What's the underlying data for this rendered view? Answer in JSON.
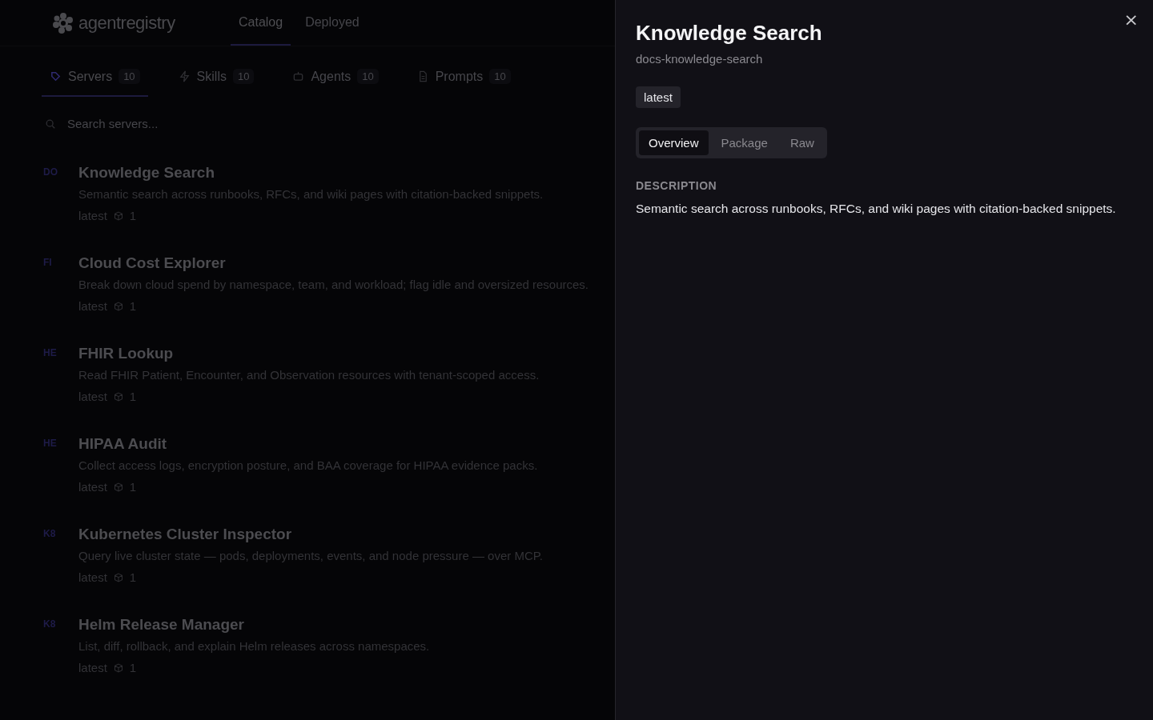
{
  "header": {
    "logo": "agentregistry",
    "nav": [
      {
        "label": "Catalog",
        "selected": true
      },
      {
        "label": "Deployed",
        "selected": false
      }
    ]
  },
  "category_tabs": [
    {
      "kind": "servers",
      "label": "Servers",
      "count": "10",
      "selected": true
    },
    {
      "kind": "skills",
      "label": "Skills",
      "count": "10",
      "selected": false
    },
    {
      "kind": "agents",
      "label": "Agents",
      "count": "10",
      "selected": false
    },
    {
      "kind": "prompts",
      "label": "Prompts",
      "count": "10",
      "selected": false
    }
  ],
  "search": {
    "placeholder": "Search servers..."
  },
  "servers": [
    {
      "initials": "DO",
      "title": "Knowledge Search",
      "description": "Semantic search across runbooks, RFCs, and wiki pages with citation-backed snippets.",
      "version": "latest",
      "packages": "1"
    },
    {
      "initials": "FI",
      "title": "Cloud Cost Explorer",
      "description": "Break down cloud spend by namespace, team, and workload; flag idle and oversized resources.",
      "version": "latest",
      "packages": "1"
    },
    {
      "initials": "HE",
      "title": "FHIR Lookup",
      "description": "Read FHIR Patient, Encounter, and Observation resources with tenant-scoped access.",
      "version": "latest",
      "packages": "1"
    },
    {
      "initials": "HE",
      "title": "HIPAA Audit",
      "description": "Collect access logs, encryption posture, and BAA coverage for HIPAA evidence packs.",
      "version": "latest",
      "packages": "1"
    },
    {
      "initials": "K8",
      "title": "Kubernetes Cluster Inspector",
      "description": "Query live cluster state — pods, deployments, events, and node pressure — over MCP.",
      "version": "latest",
      "packages": "1"
    },
    {
      "initials": "K8",
      "title": "Helm Release Manager",
      "description": "List, diff, rollback, and explain Helm releases across namespaces.",
      "version": "latest",
      "packages": "1"
    }
  ],
  "detail_panel": {
    "title": "Knowledge Search",
    "name": "docs-knowledge-search",
    "tag": "latest",
    "tabs": [
      {
        "label": "Overview",
        "selected": true
      },
      {
        "label": "Package",
        "selected": false
      },
      {
        "label": "Raw",
        "selected": false
      }
    ],
    "section_heading": "DESCRIPTION",
    "description": "Semantic search across runbooks, RFCs, and wiki pages with citation-backed snippets.",
    "close": "×"
  }
}
